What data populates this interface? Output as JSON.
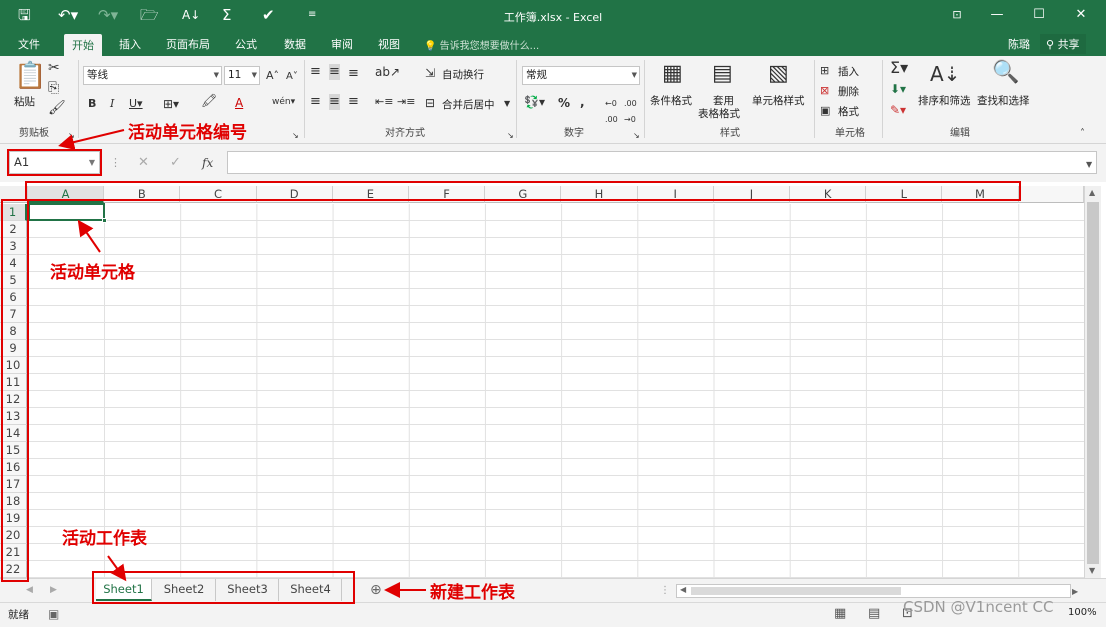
{
  "window": {
    "title": "工作簿.xlsx - Excel",
    "controls": [
      "minimize",
      "maximize",
      "close"
    ]
  },
  "tabs": [
    "文件",
    "开始",
    "插入",
    "页面布局",
    "公式",
    "数据",
    "审阅",
    "视图"
  ],
  "active_tab": "开始",
  "tell_me": "告诉我您想要做什么...",
  "user": "陈璐",
  "share": "共享",
  "ribbon": {
    "clipboard": {
      "paste": "粘贴",
      "label": "剪贴板"
    },
    "font": {
      "name": "等线",
      "size": "11"
    },
    "alignment": {
      "wrap": "自动换行",
      "merge": "合并后居中",
      "label": "对齐方式"
    },
    "number": {
      "format": "常规",
      "label": "数字"
    },
    "styles": {
      "conditional": "条件格式",
      "table1": "套用",
      "table2": "表格格式",
      "cell_styles": "单元格样式",
      "label": "样式"
    },
    "cells": {
      "insert": "插入",
      "delete": "删除",
      "format": "格式",
      "label": "单元格"
    },
    "editing": {
      "sort": "排序和筛选",
      "find": "查找和选择",
      "label": "编辑"
    }
  },
  "formula_bar": {
    "name_box": "A1",
    "fx": "fx",
    "content": ""
  },
  "columns": [
    "A",
    "B",
    "C",
    "D",
    "E",
    "F",
    "G",
    "H",
    "I",
    "J",
    "K",
    "L",
    "M"
  ],
  "rows": [
    "1",
    "2",
    "3",
    "4",
    "5",
    "6",
    "7",
    "8",
    "9",
    "10",
    "11",
    "12",
    "13",
    "14",
    "15",
    "16",
    "17",
    "18",
    "19",
    "20",
    "21",
    "22"
  ],
  "active_cell": "A1",
  "sheets": [
    "Sheet1",
    "Sheet2",
    "Sheet3",
    "Sheet4"
  ],
  "active_sheet": "Sheet1",
  "status": {
    "ready": "就绪",
    "zoom": "100%"
  },
  "annotations": {
    "name_box": "活动单元格编号",
    "active_cell": "活动单元格",
    "active_sheet": "活动工作表",
    "new_sheet": "新建工作表"
  },
  "watermark": "CSDN @V1ncent CC",
  "colors": {
    "excel_green": "#217346",
    "annotation_red": "#e00000"
  }
}
